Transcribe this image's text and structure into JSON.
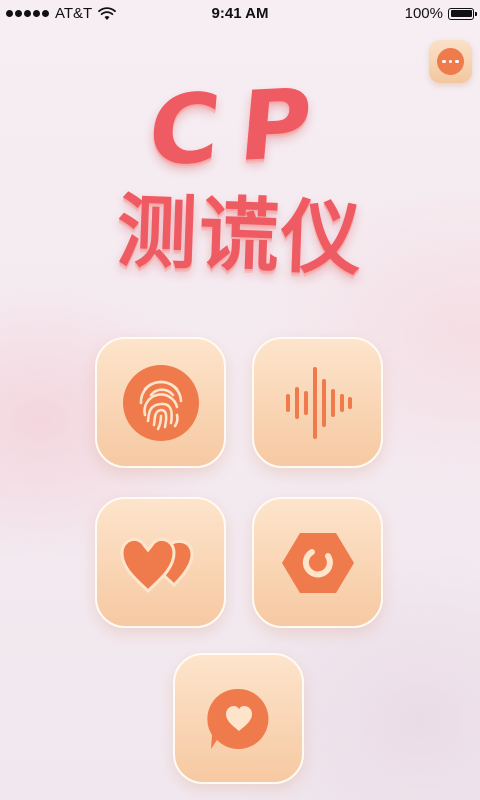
{
  "status_bar": {
    "carrier": "AT&T",
    "time": "9:41 AM",
    "battery": "100%"
  },
  "header": {
    "title_latin": "CP",
    "title_chinese": "测谎仪"
  },
  "buttons": [
    {
      "icon": "fingerprint-icon"
    },
    {
      "icon": "sound-wave-icon"
    },
    {
      "icon": "double-heart-icon"
    },
    {
      "icon": "hexagon-spinner-icon"
    },
    {
      "icon": "heart-chat-bubble-icon"
    }
  ],
  "colors": {
    "accent": "#ef7a4b",
    "title": "#ee5b62",
    "tile_top": "#fde4cb",
    "tile_bottom": "#f6c9a2"
  }
}
